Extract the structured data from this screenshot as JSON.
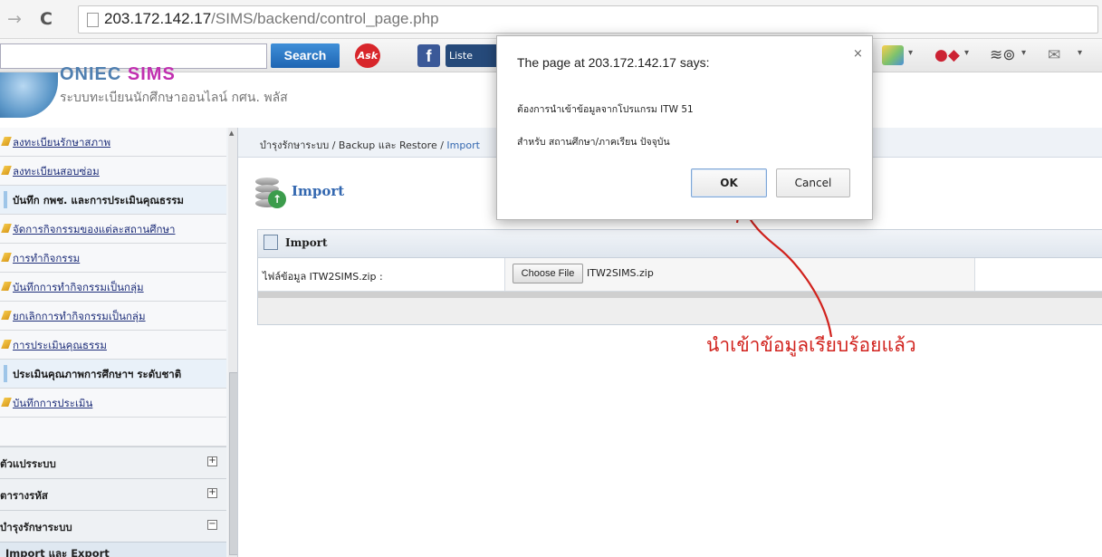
{
  "browser": {
    "url_host": "203.172.142.17",
    "url_path": "/SIMS/backend/control_page.php",
    "back_icon": "arrow-right-icon",
    "reload_icon": "reload-icon"
  },
  "toolbar": {
    "search_label": "Search",
    "ask_label": "Ask",
    "facebook_label": "f",
    "listen_label": "Liste"
  },
  "header": {
    "brand": "ONIEC ",
    "brand_sims": "SIMS",
    "subtitle": "ระบบทะเบียนนักศึกษาออนไลน์ กศน. พลัส"
  },
  "sidebar": {
    "items": [
      {
        "label": "ลงทะเบียนรักษาสภาพ",
        "type": "link"
      },
      {
        "label": "ลงทะเบียนสอบซ่อม",
        "type": "link"
      },
      {
        "label": "บันทึก กพช. และการประเมินคุณธรรม",
        "type": "head"
      },
      {
        "label": "จัดการกิจกรรมของแต่ละสถานศึกษา",
        "type": "link"
      },
      {
        "label": "การทำกิจกรรม",
        "type": "link"
      },
      {
        "label": "บันทึกการทำกิจกรรมเป็นกลุ่ม",
        "type": "link"
      },
      {
        "label": "ยกเลิกการทำกิจกรรมเป็นกลุ่ม",
        "type": "link"
      },
      {
        "label": "การประเมินคุณธรรม",
        "type": "link"
      },
      {
        "label": "ประเมินคุณภาพการศึกษาฯ ระดับชาติ",
        "type": "head"
      },
      {
        "label": "บันทึกการประเมิน",
        "type": "link"
      }
    ],
    "groups": [
      {
        "label": "ตัวแปรระบบ",
        "toggle": "+"
      },
      {
        "label": "ตารางรหัส",
        "toggle": "+"
      },
      {
        "label": "บำรุงรักษาระบบ",
        "toggle": "−"
      }
    ],
    "subgroup": "Import และ Export"
  },
  "breadcrumb": {
    "path": "บำรุงรักษาระบบ / Backup และ Restore / ",
    "current": "Import"
  },
  "page": {
    "title": "Import"
  },
  "panel": {
    "title": "Import",
    "field_label": "ไฟล์ข้อมูล ITW2SIMS.zip :",
    "choose_label": "Choose File",
    "file_name": "ITW2SIMS.zip"
  },
  "annotation": {
    "text": "นำเข้าข้อมูลเรียบร้อยแล้ว",
    "color": "#d1221d"
  },
  "dialog": {
    "title": "The page at 203.172.142.17 says:",
    "message_line1": "ต้องการนำเข้าข้อมูลจากโปรแกรม ITW 51",
    "message_line2": "สำหรับ สถานศึกษา/ภาคเรียน ปัจจุบัน",
    "ok_label": "OK",
    "cancel_label": "Cancel",
    "close_label": "×"
  }
}
